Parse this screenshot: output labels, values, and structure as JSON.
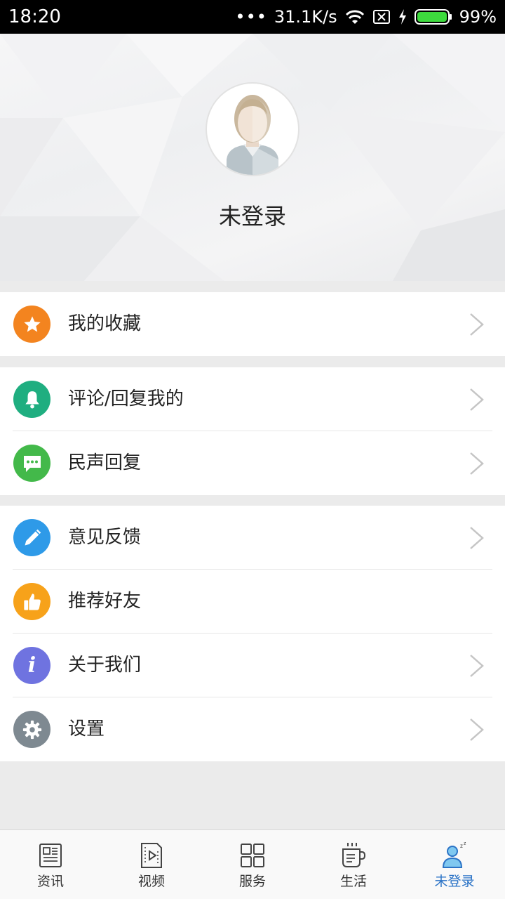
{
  "status_bar": {
    "time": "18:20",
    "network_speed": "31.1K/s",
    "battery": "99%",
    "icons": [
      "more-dots-icon",
      "wifi-icon",
      "no-sim-icon",
      "charging-icon",
      "battery-icon"
    ]
  },
  "profile": {
    "username": "未登录",
    "avatar_icon": "default-avatar-icon"
  },
  "menu": {
    "group1": [
      {
        "label": "我的收藏",
        "icon": "star-icon",
        "color": "#f3841f"
      }
    ],
    "group2": [
      {
        "label": "评论/回复我的",
        "icon": "bell-icon",
        "color": "#1fae80"
      },
      {
        "label": "民声回复",
        "icon": "chat-icon",
        "color": "#43b94a"
      }
    ],
    "group3": [
      {
        "label": "意见反馈",
        "icon": "pencil-icon",
        "color": "#2e9ae8"
      },
      {
        "label": "推荐好友",
        "icon": "thumbs-up-icon",
        "color": "#f7a21a"
      },
      {
        "label": "关于我们",
        "icon": "info-icon",
        "color": "#6f73e0"
      },
      {
        "label": "设置",
        "icon": "gear-icon",
        "color": "#7e8991"
      }
    ]
  },
  "bottom_nav": {
    "items": [
      {
        "label": "资讯",
        "icon": "news-icon"
      },
      {
        "label": "视频",
        "icon": "video-icon"
      },
      {
        "label": "服务",
        "icon": "grid-icon"
      },
      {
        "label": "生活",
        "icon": "coffee-icon"
      },
      {
        "label": "未登录",
        "icon": "user-sleep-icon",
        "active": true
      }
    ],
    "active_color": "#2b73c6"
  }
}
